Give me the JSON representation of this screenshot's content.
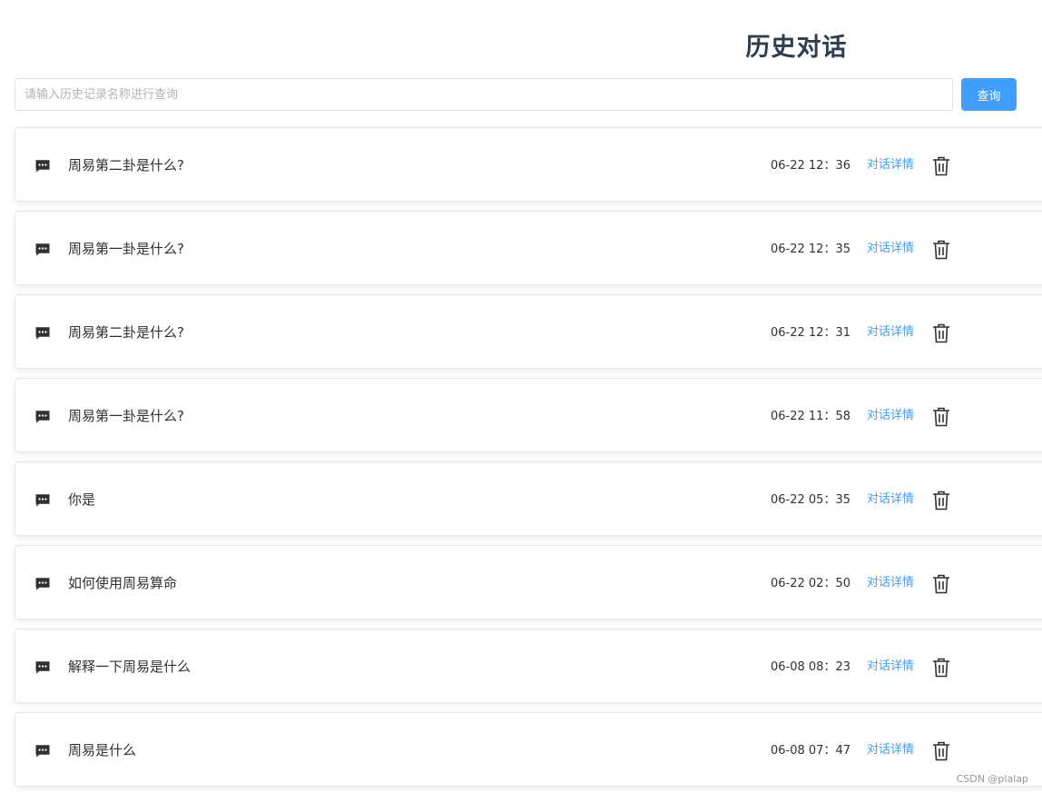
{
  "header": {
    "title": "历史对话"
  },
  "search": {
    "placeholder": "请输入历史记录名称进行查询",
    "value": "",
    "button_label": "查询"
  },
  "conversations": [
    {
      "title": "周易第二卦是什么?",
      "time": "06-22 12：36",
      "action_label": "对话详情"
    },
    {
      "title": "周易第一卦是什么?",
      "time": "06-22 12：35",
      "action_label": "对话详情"
    },
    {
      "title": "周易第二卦是什么?",
      "time": "06-22 12：31",
      "action_label": "对话详情"
    },
    {
      "title": "周易第一卦是什么?",
      "time": "06-22 11：58",
      "action_label": "对话详情"
    },
    {
      "title": "你是",
      "time": "06-22 05：35",
      "action_label": "对话详情"
    },
    {
      "title": "如何使用周易算命",
      "time": "06-22 02：50",
      "action_label": "对话详情"
    },
    {
      "title": "解释一下周易是什么",
      "time": "06-08 08：23",
      "action_label": "对话详情"
    },
    {
      "title": "周易是什么",
      "time": "06-08 07：47",
      "action_label": "对话详情"
    }
  ],
  "icons": {
    "row_icon": "chat-bubble-icon",
    "delete_icon": "trash-icon"
  },
  "colors": {
    "accent": "#409eff",
    "title": "#2c3e50",
    "text": "#303133"
  },
  "watermark": "CSDN @plalap"
}
